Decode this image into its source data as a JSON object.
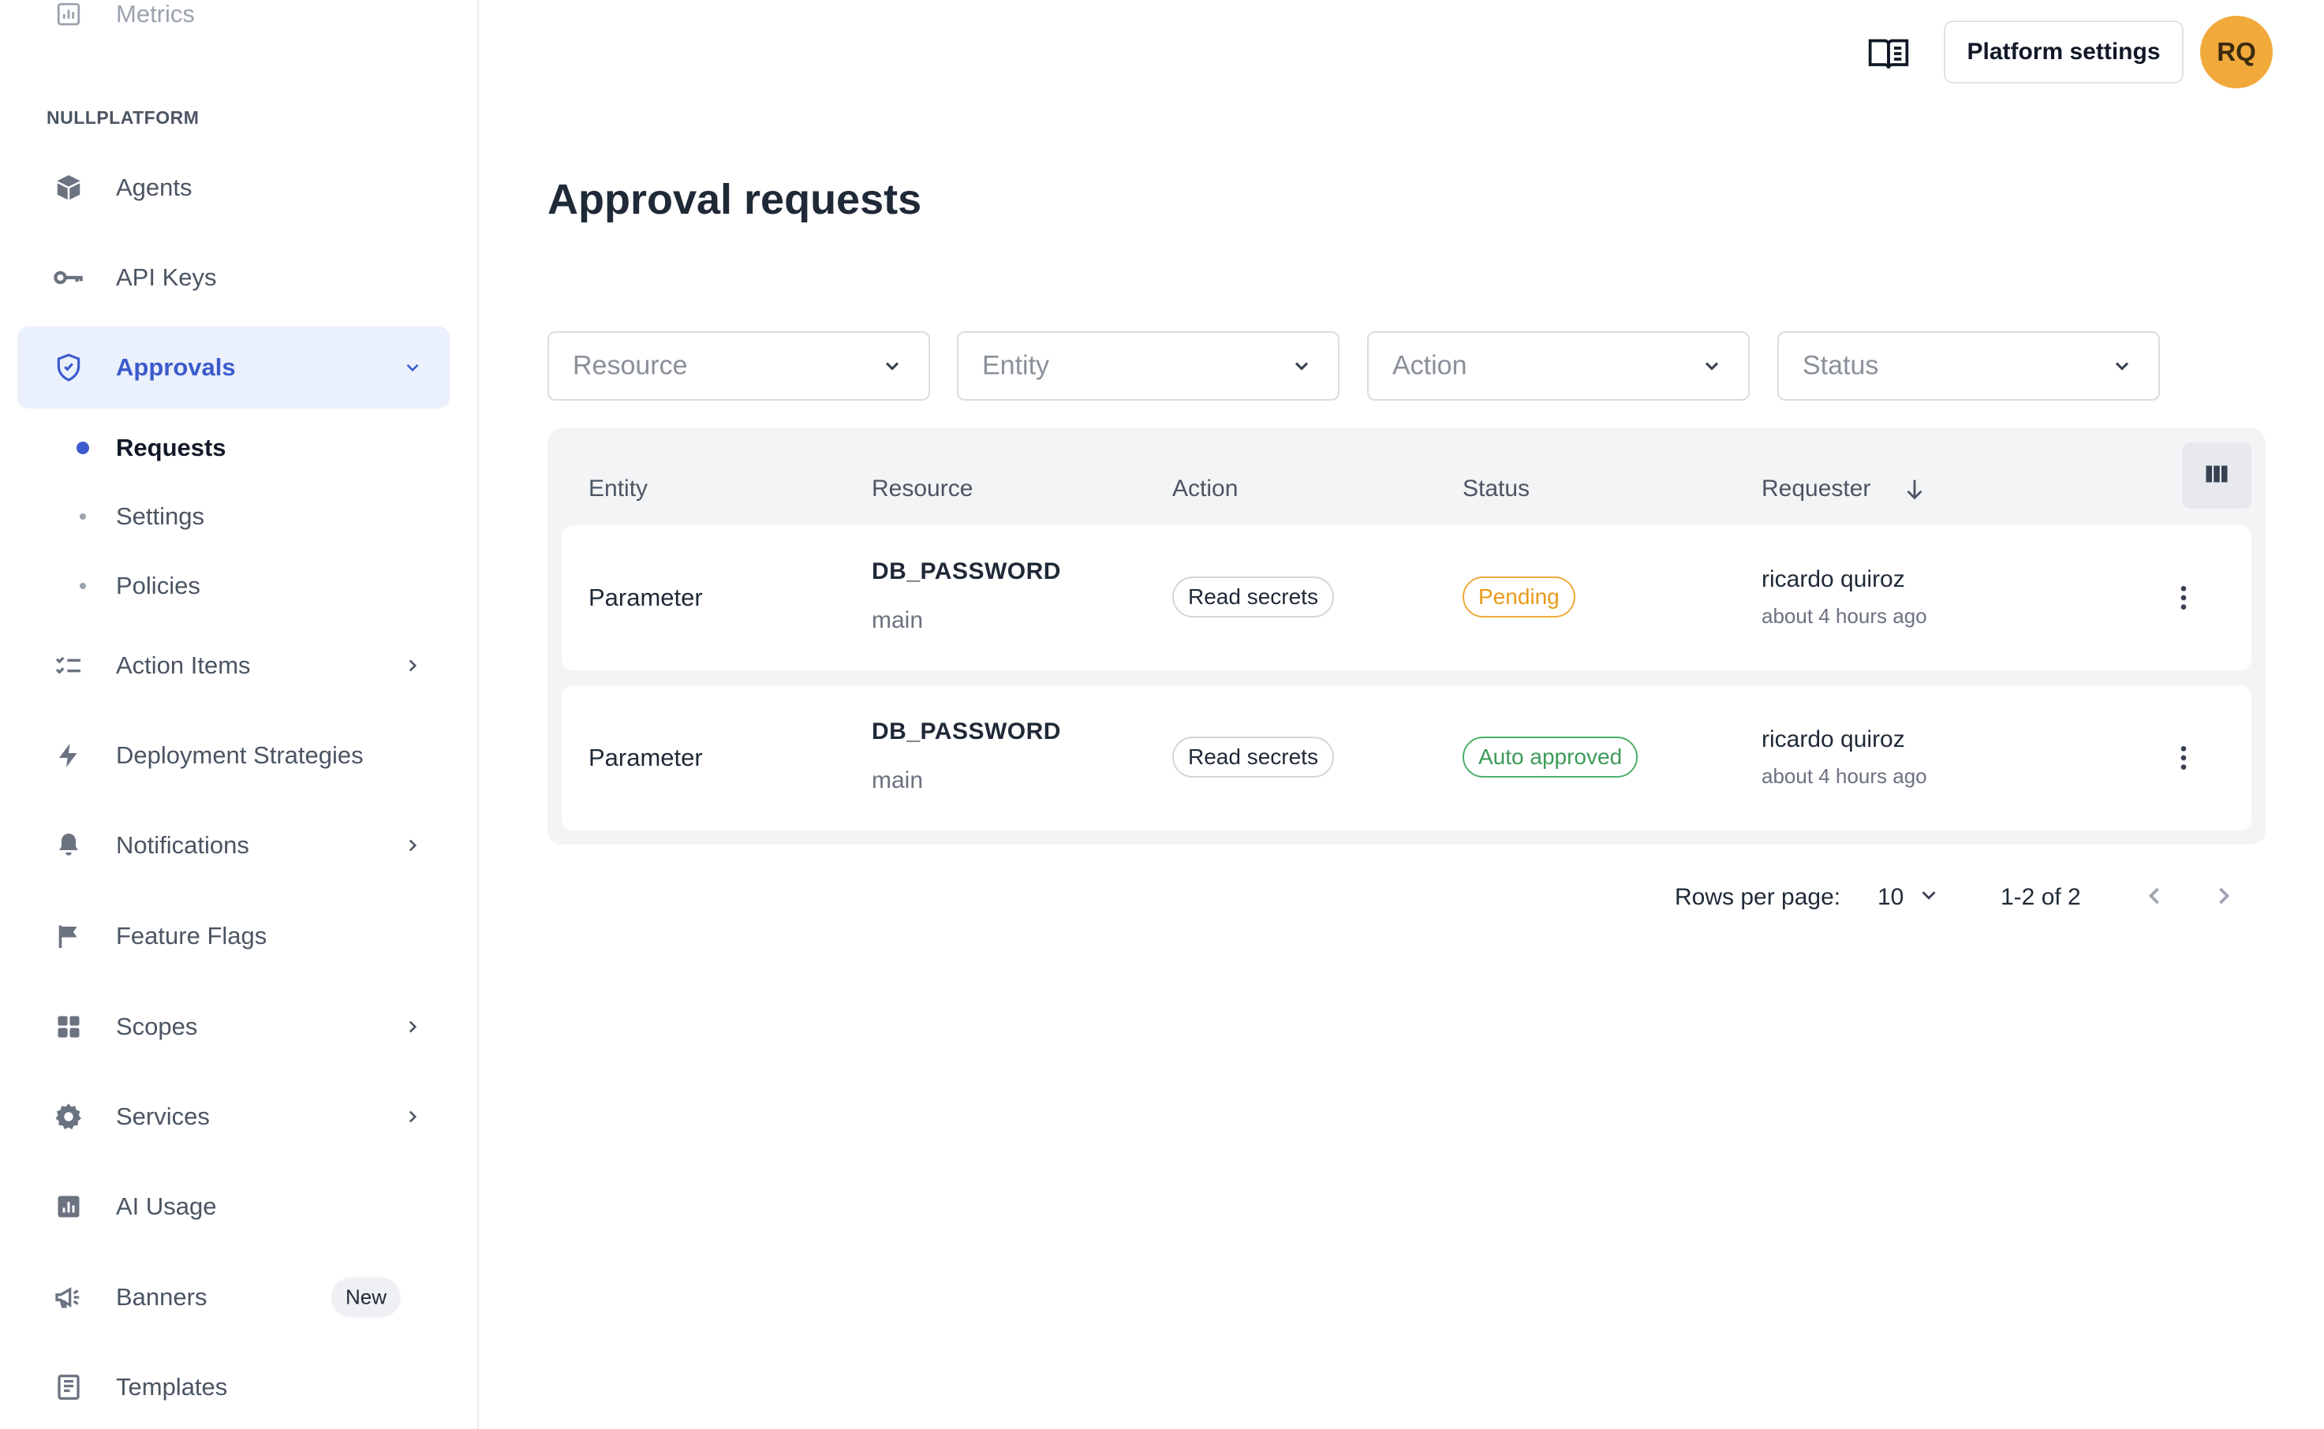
{
  "sidebar": {
    "metrics_label": "Metrics",
    "section_title": "NULLPLATFORM",
    "items": {
      "agents": "Agents",
      "api_keys": "API Keys",
      "approvals": "Approvals",
      "action_items": "Action Items",
      "deployment_strategies": "Deployment Strategies",
      "notifications": "Notifications",
      "feature_flags": "Feature Flags",
      "scopes": "Scopes",
      "services": "Services",
      "ai_usage": "AI Usage",
      "banners": "Banners",
      "templates": "Templates"
    },
    "approvals_sub": {
      "requests": "Requests",
      "settings": "Settings",
      "policies": "Policies"
    },
    "banners_badge": "New"
  },
  "header": {
    "settings_button": "Platform settings",
    "avatar_initials": "RQ"
  },
  "page": {
    "title": "Approval requests"
  },
  "filters": {
    "resource": "Resource",
    "entity": "Entity",
    "action": "Action",
    "status": "Status"
  },
  "table": {
    "columns": [
      "Entity",
      "Resource",
      "Action",
      "Status",
      "Requester"
    ],
    "rows": [
      {
        "entity": "Parameter",
        "resource_name": "DB_PASSWORD",
        "resource_sub": "main",
        "action": "Read secrets",
        "status": "Pending",
        "requester": "ricardo quiroz",
        "time": "about 4 hours ago"
      },
      {
        "entity": "Parameter",
        "resource_name": "DB_PASSWORD",
        "resource_sub": "main",
        "action": "Read secrets",
        "status": "Auto approved",
        "requester": "ricardo quiroz",
        "time": "about 4 hours ago"
      }
    ]
  },
  "pagination": {
    "rows_label": "Rows per page:",
    "rows_value": "10",
    "range": "1-2 of 2"
  },
  "colors": {
    "accent": "#3b5bcc",
    "active_bg": "#eaf0fc",
    "avatar": "#f0a93a",
    "pending": "#e89a1a",
    "approved": "#3d9a59"
  }
}
